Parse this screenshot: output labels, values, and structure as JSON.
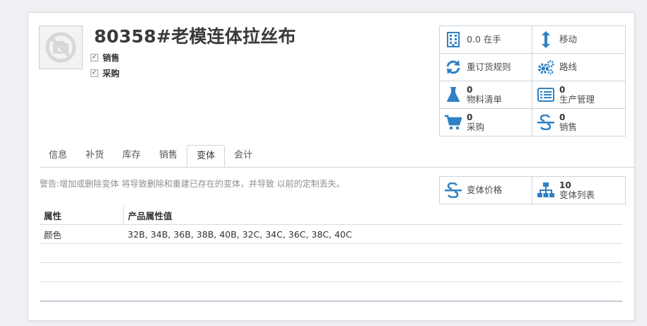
{
  "product": {
    "title": "80358#老模连体拉丝布",
    "checkboxes": [
      {
        "label": "销售",
        "checked": true
      },
      {
        "label": "采购",
        "checked": true
      }
    ]
  },
  "smart_buttons": [
    {
      "icon": "building-icon",
      "label": "0.0 在手"
    },
    {
      "icon": "arrows-vertical-icon",
      "label": "移动"
    },
    {
      "icon": "refresh-icon",
      "label": "重订货规则"
    },
    {
      "icon": "gears-icon",
      "label": "路线"
    },
    {
      "icon": "flask-icon",
      "number": "0",
      "label": "物料清单"
    },
    {
      "icon": "list-alt-icon",
      "number": "0",
      "label": "生产管理"
    },
    {
      "icon": "shopping-cart-icon",
      "number": "0",
      "label": "采购"
    },
    {
      "icon": "strikethrough-icon",
      "number": "0",
      "label": "销售"
    }
  ],
  "variant_buttons": [
    {
      "icon": "strikethrough-icon",
      "label": "变体价格"
    },
    {
      "icon": "sitemap-icon",
      "number": "10",
      "label": "变体列表"
    }
  ],
  "tabs": [
    {
      "label": "信息",
      "active": false
    },
    {
      "label": "补货",
      "active": false
    },
    {
      "label": "库存",
      "active": false
    },
    {
      "label": "销售",
      "active": false
    },
    {
      "label": "变体",
      "active": true
    },
    {
      "label": "会计",
      "active": false
    }
  ],
  "warning": "警告:增加或删除变体 将导致删除和重建已存在的变体，并导致 以前的定制丢失。",
  "attribute_table": {
    "headers": [
      "属性",
      "产品属性值"
    ],
    "rows": [
      [
        "颜色",
        "32B, 34B, 36B, 38B, 40B, 32C, 34C, 36C, 38C, 40C"
      ]
    ]
  },
  "colors": {
    "accent": "#2f80c4",
    "border": "#ccd3db"
  }
}
